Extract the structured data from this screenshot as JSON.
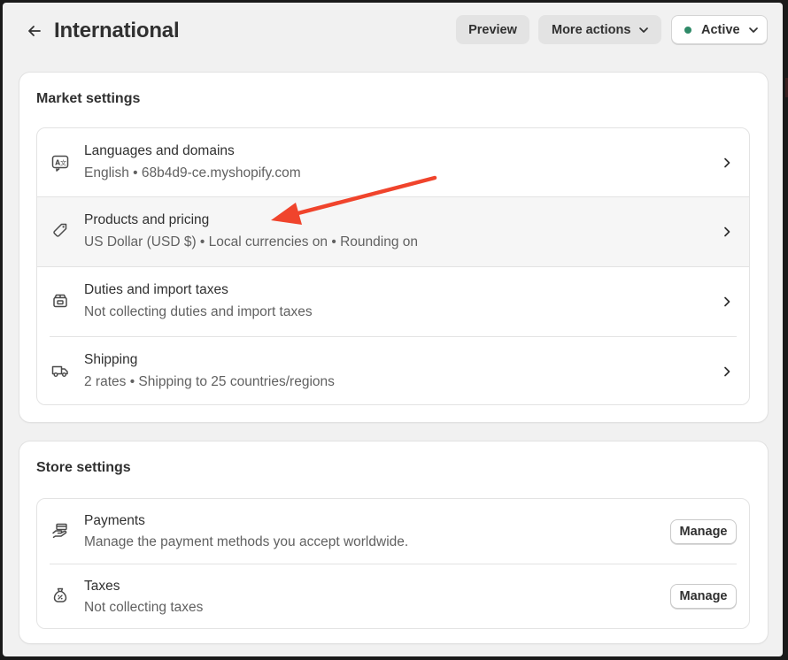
{
  "header": {
    "title": "International",
    "preview_label": "Preview",
    "more_actions_label": "More actions",
    "status_label": "Active",
    "status_color": "#2f8a68"
  },
  "market_settings": {
    "title": "Market settings",
    "items": [
      {
        "title": "Languages and domains",
        "subtitle": "English • 68b4d9-ce.myshopify.com",
        "icon": "translate-icon"
      },
      {
        "title": "Products and pricing",
        "subtitle": "US Dollar (USD $) • Local currencies on • Rounding on",
        "icon": "tag-icon"
      },
      {
        "title": "Duties and import taxes",
        "subtitle": "Not collecting duties and import taxes",
        "icon": "package-icon"
      },
      {
        "title": "Shipping",
        "subtitle": "2 rates • Shipping to 25 countries/regions",
        "icon": "truck-icon"
      }
    ]
  },
  "store_settings": {
    "title": "Store settings",
    "items": [
      {
        "title": "Payments",
        "subtitle": "Manage the payment methods you accept worldwide.",
        "button_label": "Manage",
        "icon": "payment-hand-icon"
      },
      {
        "title": "Taxes",
        "subtitle": "Not collecting taxes",
        "button_label": "Manage",
        "icon": "tax-bag-icon"
      }
    ]
  },
  "annotation": {
    "arrow_color": "#f0442c"
  }
}
